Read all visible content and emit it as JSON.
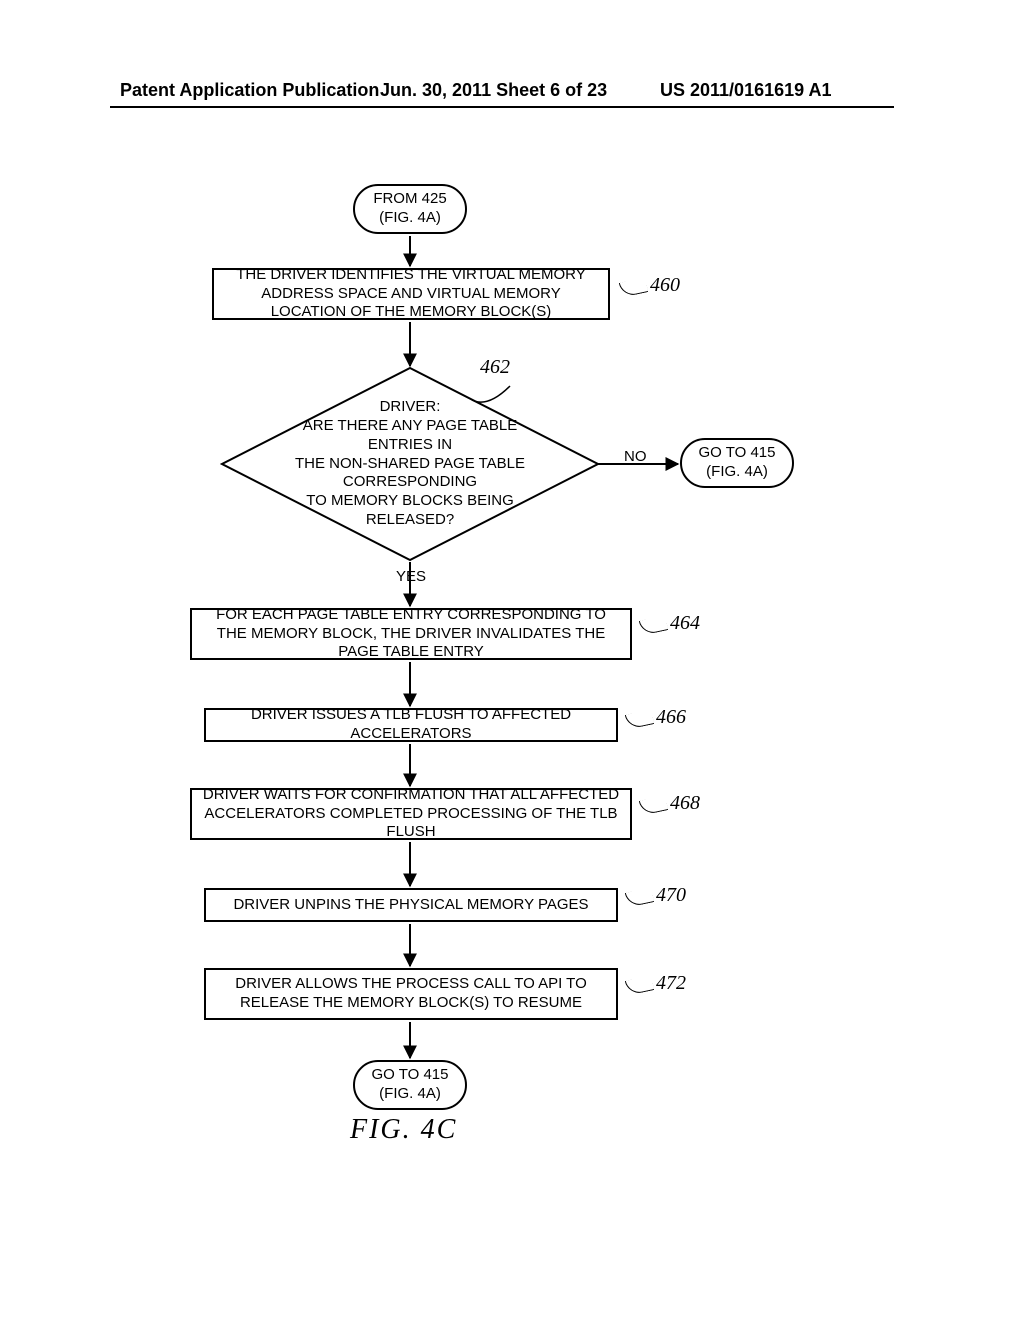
{
  "header": {
    "left": "Patent Application Publication",
    "mid": "Jun. 30, 2011  Sheet 6 of 23",
    "right": "US 2011/0161619 A1"
  },
  "nodes": {
    "start": {
      "line1": "FROM 425",
      "line2": "(FIG. 4A)"
    },
    "s460": "THE DRIVER IDENTIFIES THE VIRTUAL MEMORY ADDRESS SPACE AND VIRTUAL MEMORY LOCATION OF THE MEMORY BLOCK(S)",
    "d462": {
      "l1": "DRIVER:",
      "l2": "ARE THERE ANY PAGE TABLE ENTRIES IN",
      "l3": "THE NON-SHARED PAGE TABLE CORRESPONDING",
      "l4": "TO MEMORY BLOCKS BEING",
      "l5": "RELEASED?"
    },
    "goto415r": {
      "line1": "GO TO 415",
      "line2": "(FIG. 4A)"
    },
    "s464": "FOR EACH PAGE TABLE ENTRY CORRESPONDING TO THE MEMORY BLOCK, THE DRIVER INVALIDATES THE PAGE TABLE ENTRY",
    "s466": "DRIVER ISSUES A TLB FLUSH TO AFFECTED ACCELERATORS",
    "s468": "DRIVER WAITS FOR CONFIRMATION THAT ALL AFFECTED ACCELERATORS COMPLETED PROCESSING OF THE TLB FLUSH",
    "s470": "DRIVER UNPINS THE PHYSICAL MEMORY PAGES",
    "s472": "DRIVER ALLOWS THE PROCESS CALL TO API TO RELEASE THE MEMORY BLOCK(S) TO RESUME",
    "end": {
      "line1": "GO TO 415",
      "line2": "(FIG. 4A)"
    }
  },
  "edges": {
    "yes": "YES",
    "no": "NO"
  },
  "refs": {
    "r460": "460",
    "r462": "462",
    "r464": "464",
    "r466": "466",
    "r468": "468",
    "r470": "470",
    "r472": "472"
  },
  "caption": "FIG. 4C",
  "chart_data": {
    "type": "flowchart",
    "nodes": [
      {
        "id": "start",
        "kind": "terminator",
        "text": "FROM 425 (FIG. 4A)"
      },
      {
        "id": "s460",
        "kind": "process",
        "ref": "460",
        "text": "THE DRIVER IDENTIFIES THE VIRTUAL MEMORY ADDRESS SPACE AND VIRTUAL MEMORY LOCATION OF THE MEMORY BLOCK(S)"
      },
      {
        "id": "d462",
        "kind": "decision",
        "ref": "462",
        "text": "DRIVER: ARE THERE ANY PAGE TABLE ENTRIES IN THE NON-SHARED PAGE TABLE CORRESPONDING TO MEMORY BLOCKS BEING RELEASED?"
      },
      {
        "id": "goto415r",
        "kind": "terminator",
        "text": "GO TO 415 (FIG. 4A)"
      },
      {
        "id": "s464",
        "kind": "process",
        "ref": "464",
        "text": "FOR EACH PAGE TABLE ENTRY CORRESPONDING TO THE MEMORY BLOCK, THE DRIVER INVALIDATES THE PAGE TABLE ENTRY"
      },
      {
        "id": "s466",
        "kind": "process",
        "ref": "466",
        "text": "DRIVER ISSUES A TLB FLUSH TO AFFECTED ACCELERATORS"
      },
      {
        "id": "s468",
        "kind": "process",
        "ref": "468",
        "text": "DRIVER WAITS FOR CONFIRMATION THAT ALL AFFECTED ACCELERATORS COMPLETED PROCESSING OF THE TLB FLUSH"
      },
      {
        "id": "s470",
        "kind": "process",
        "ref": "470",
        "text": "DRIVER UNPINS THE PHYSICAL MEMORY PAGES"
      },
      {
        "id": "s472",
        "kind": "process",
        "ref": "472",
        "text": "DRIVER ALLOWS THE PROCESS CALL TO API TO RELEASE THE MEMORY BLOCK(S) TO RESUME"
      },
      {
        "id": "end",
        "kind": "terminator",
        "text": "GO TO 415 (FIG. 4A)"
      }
    ],
    "edges": [
      {
        "from": "start",
        "to": "s460"
      },
      {
        "from": "s460",
        "to": "d462"
      },
      {
        "from": "d462",
        "to": "goto415r",
        "label": "NO"
      },
      {
        "from": "d462",
        "to": "s464",
        "label": "YES"
      },
      {
        "from": "s464",
        "to": "s466"
      },
      {
        "from": "s466",
        "to": "s468"
      },
      {
        "from": "s468",
        "to": "s470"
      },
      {
        "from": "s470",
        "to": "s472"
      },
      {
        "from": "s472",
        "to": "end"
      }
    ],
    "caption": "FIG. 4C"
  }
}
